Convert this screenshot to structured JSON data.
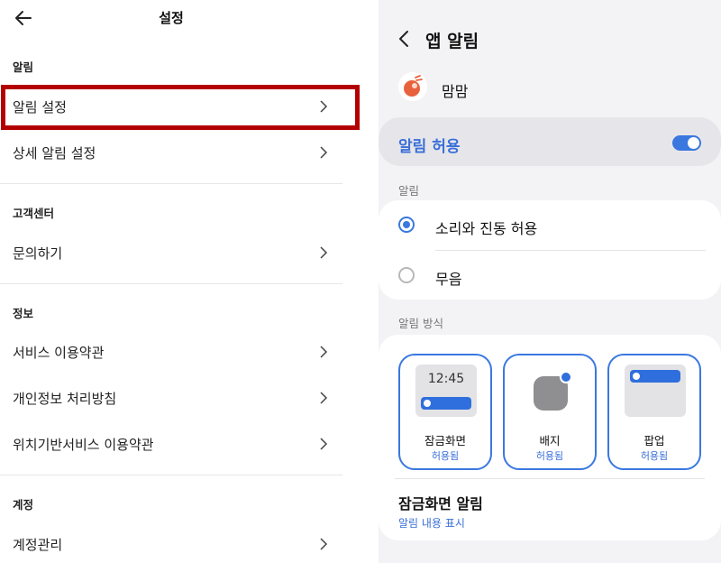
{
  "left": {
    "header": {
      "title": "설정"
    },
    "sections": [
      {
        "title": "알림",
        "items": [
          "알림 설정",
          "상세 알림 설정"
        ]
      },
      {
        "title": "고객센터",
        "items": [
          "문의하기"
        ]
      },
      {
        "title": "정보",
        "items": [
          "서비스 이용약관",
          "개인정보 처리방침",
          "위치기반서비스 이용약관"
        ]
      },
      {
        "title": "계정",
        "items": [
          "계정관리"
        ]
      }
    ]
  },
  "right": {
    "header": {
      "title": "앱 알림"
    },
    "app": {
      "name": "맘맘",
      "icon": "app-logo-icon"
    },
    "allow": {
      "label": "알림 허용",
      "enabled": true
    },
    "sound": {
      "section_title": "알림",
      "options": [
        {
          "label": "소리와 진동 허용",
          "selected": true
        },
        {
          "label": "무음",
          "selected": false
        }
      ]
    },
    "style": {
      "section_title": "알림 방식",
      "tiles": [
        {
          "name": "잠금화면",
          "status": "허용됨",
          "time": "12:45"
        },
        {
          "name": "배지",
          "status": "허용됨"
        },
        {
          "name": "팝업",
          "status": "허용됨"
        }
      ],
      "lock_screen": {
        "title": "잠금화면 알림",
        "value": "알림 내용 표시"
      }
    }
  },
  "colors": {
    "accent": "#3a78e0",
    "highlight_border": "#b30000",
    "card_bg": "#ffffff",
    "panel_bg": "#f3f3f5"
  }
}
